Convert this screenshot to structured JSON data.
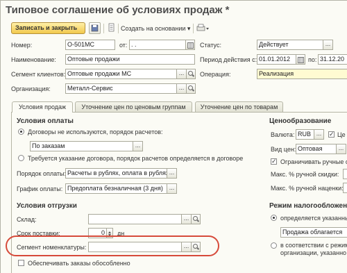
{
  "window": {
    "title": "Типовое соглашение об условиях продаж *"
  },
  "toolbar": {
    "save_close": "Записать и закрыть",
    "create_based": "Создать на основании",
    "create_based_arrow": "▾"
  },
  "header": {
    "number_label": "Номер:",
    "number_value": "О-501МС",
    "from_label": "от:",
    "from_value": ".  .",
    "status_label": "Статус:",
    "status_value": "Действует",
    "name_label": "Наименование:",
    "name_value": "Оптовые продажи",
    "period_label": "Период действия с:",
    "period_from": "01.01.2012",
    "period_to_label": "по:",
    "period_to": "31.12.20",
    "segment_label": "Сегмент клиентов:",
    "segment_value": "Оптовые продажи МС",
    "operation_label": "Операция:",
    "operation_value": "Реализация",
    "org_label": "Организация:",
    "org_value": "Металл-Сервис"
  },
  "tabs": [
    {
      "label": "Условия продаж",
      "active": true
    },
    {
      "label": "Уточнение цен по ценовым группам",
      "active": false
    },
    {
      "label": "Уточнение цен по товарам",
      "active": false
    }
  ],
  "payment": {
    "title": "Условия оплаты",
    "radio1": "Договоры не используются, порядок расчетов:",
    "radio1_value": "По заказам",
    "radio2": "Требуется указание договора, порядок расчетов определяется в договоре",
    "order_label": "Порядок оплаты:",
    "order_value": "Расчеты в рублях, оплата в рублях",
    "schedule_label": "График оплаты:",
    "schedule_value": "Предоплата безналичная (3 дня)"
  },
  "shipping": {
    "title": "Условия отгрузки",
    "warehouse_label": "Склад:",
    "warehouse_value": "",
    "delivery_label": "Срок поставки:",
    "delivery_value": "0",
    "delivery_unit": "дн",
    "nomenclature_label": "Сегмент номенклатуры:",
    "nomenclature_value": "",
    "separate_label": "Обеспечивать заказы обособленно"
  },
  "pricing": {
    "title": "Ценообразование",
    "currency_label": "Валюта:",
    "currency_value": "RUB",
    "currency_check_label": "Це",
    "price_type_label": "Вид цен:",
    "price_type_value": "Оптовая",
    "limit_manual": "Ограничивать ручные с",
    "max_discount_label": "Макс. % ручной скидки:",
    "max_markup_label": "Макс. % ручной наценки:"
  },
  "tax": {
    "title": "Режим налогообложен",
    "radio1": "определяется указанны",
    "radio1_value": "Продажа облагается",
    "radio2_line1": "в соответствии с режим",
    "radio2_line2": "организации, указанно"
  },
  "colors": {
    "accent_button": "#f2c84c",
    "annotation": "#d64a3a",
    "operation_field": "#fffbd2"
  }
}
